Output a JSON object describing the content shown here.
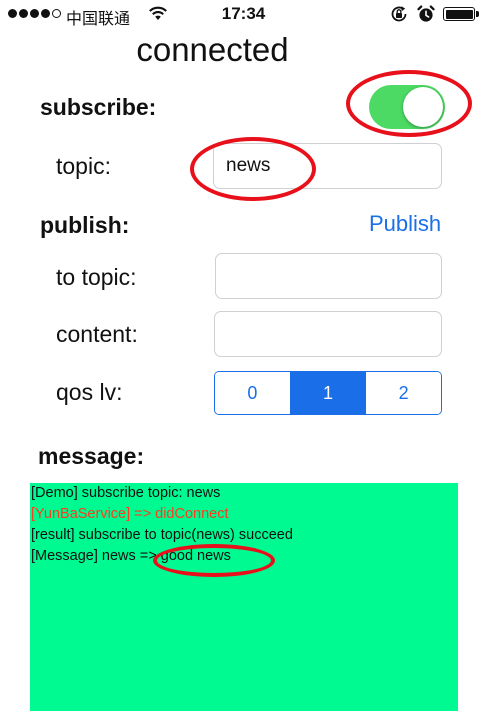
{
  "status_bar": {
    "carrier": "中国联通",
    "time": "17:34",
    "signal_icon": "signal-dots-icon",
    "wifi_icon": "wifi-icon",
    "orientation_lock_icon": "orientation-lock-icon",
    "alarm_icon": "alarm-clock-icon",
    "battery_icon": "battery-icon"
  },
  "header": {
    "title": "connected"
  },
  "subscribe": {
    "label": "subscribe:",
    "toggle_on": true,
    "topic_label": "topic:",
    "topic_value": "news"
  },
  "publish": {
    "label": "publish:",
    "button_label": "Publish",
    "to_topic_label": "to topic:",
    "to_topic_value": "",
    "content_label": "content:",
    "content_value": "",
    "qos_label": "qos lv:",
    "qos_options": [
      "0",
      "1",
      "2"
    ],
    "qos_selected": "1"
  },
  "message": {
    "label": "message:",
    "lines": [
      "[Demo]  subscribe topic: news",
      "[YunBaService] => didConnect",
      "[result] subscribe to topic(news) succeed",
      "[Message] news => good news"
    ]
  },
  "colors": {
    "accent_blue": "#1a6fe8",
    "toggle_green": "#4cd964",
    "log_background": "#00fa92",
    "log_error_text": "#ff3b1e",
    "annotation_red": "#e8111b"
  }
}
